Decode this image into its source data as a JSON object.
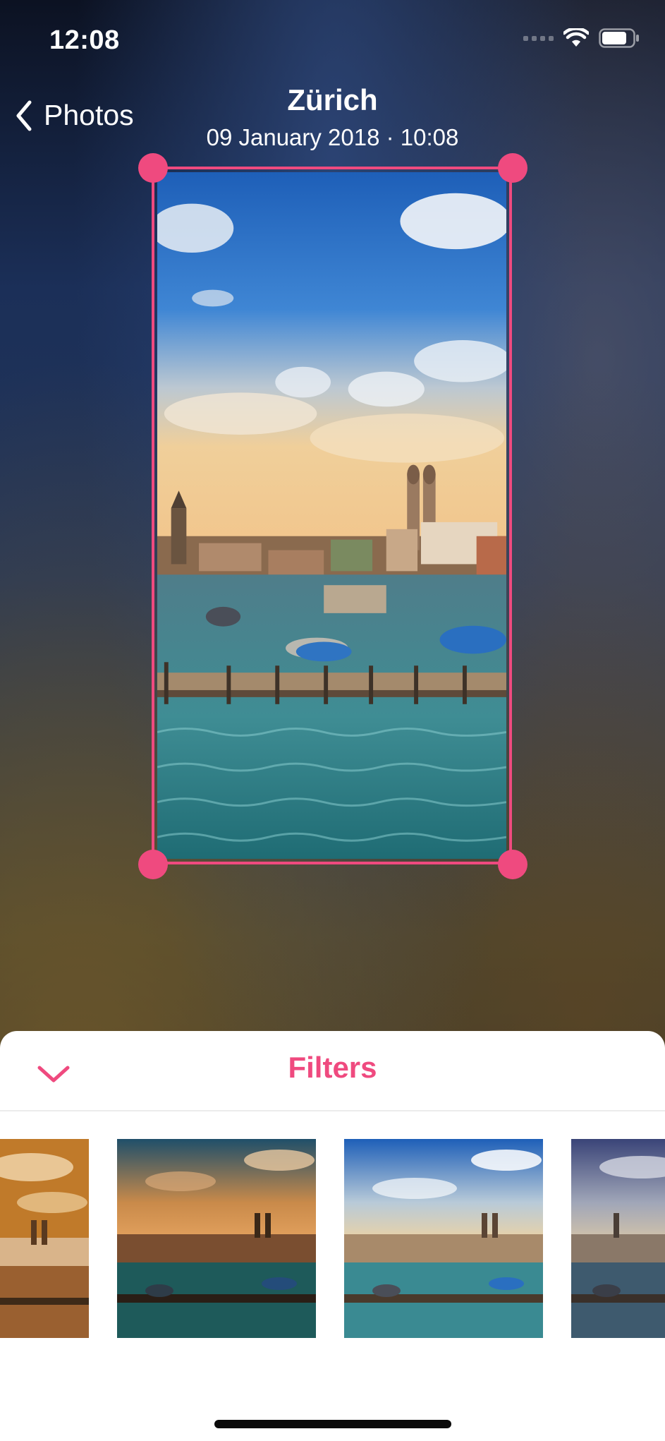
{
  "status_bar": {
    "time": "12:08",
    "signal_icon": "cellular-signal-dots-icon",
    "wifi_icon": "wifi-icon",
    "battery_icon": "battery-icon"
  },
  "nav": {
    "back_label": "Photos",
    "back_icon": "chevron-left-icon",
    "title": "Zürich",
    "subtitle": "09 January 2018 · 10:08"
  },
  "editor": {
    "accent_color": "#ef4a7f",
    "photo": "zurich-limmat-river-photo"
  },
  "filters_sheet": {
    "title": "Filters",
    "collapse_icon": "chevron-down-icon",
    "thumbnails": [
      {
        "name": "sepia-filter"
      },
      {
        "name": "teal-orange-filter"
      },
      {
        "name": "vivid-filter"
      },
      {
        "name": "cool-faded-filter"
      }
    ]
  }
}
